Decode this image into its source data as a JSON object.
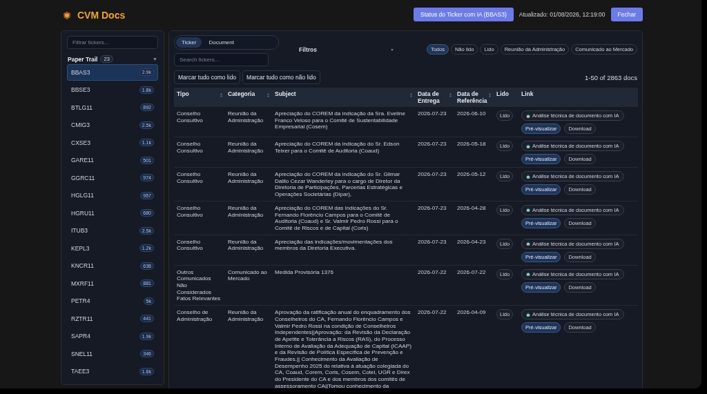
{
  "header": {
    "title": "CVM Docs",
    "status_button": "Status do Ticker com IA (BBAS3)",
    "updated": "Atualizado: 01/08/2026, 12:19:00",
    "close_button": "Fechar"
  },
  "sidebar": {
    "filter_placeholder": "Filtrar tickers...",
    "section": {
      "title": "Paper Trail",
      "count": "23",
      "expanded": true
    },
    "items": [
      {
        "label": "BBAS3",
        "count": "2.9k",
        "selected": true
      },
      {
        "label": "BBSE3",
        "count": "1.8k",
        "selected": false
      },
      {
        "label": "BTLG11",
        "count": "892",
        "selected": false
      },
      {
        "label": "CMIG3",
        "count": "2.5k",
        "selected": false
      },
      {
        "label": "CXSE3",
        "count": "1.1k",
        "selected": false
      },
      {
        "label": "GARE11",
        "count": "501",
        "selected": false
      },
      {
        "label": "GGRC11",
        "count": "974",
        "selected": false
      },
      {
        "label": "HGLG11",
        "count": "957",
        "selected": false
      },
      {
        "label": "HGRU11",
        "count": "680",
        "selected": false
      },
      {
        "label": "ITUB3",
        "count": "2.5k",
        "selected": false
      },
      {
        "label": "KEPL3",
        "count": "1.2k",
        "selected": false
      },
      {
        "label": "KNCR11",
        "count": "638",
        "selected": false
      },
      {
        "label": "MXRF11",
        "count": "881",
        "selected": false
      },
      {
        "label": "PETR4",
        "count": "5k",
        "selected": false
      },
      {
        "label": "RZTR11",
        "count": "441",
        "selected": false
      },
      {
        "label": "SAPR4",
        "count": "1.9k",
        "selected": false
      },
      {
        "label": "SNEL11",
        "count": "346",
        "selected": false
      },
      {
        "label": "TAEE3",
        "count": "1.6k",
        "selected": false
      }
    ]
  },
  "tabs": [
    {
      "label": "Ticker",
      "selected": true
    },
    {
      "label": "Document",
      "selected": false
    }
  ],
  "search": {
    "placeholder": "Search tickers..."
  },
  "filters": {
    "title": "Filtros",
    "expanded": false,
    "chips": [
      {
        "label": "Todos",
        "selected": true
      },
      {
        "label": "Não lido",
        "selected": false
      },
      {
        "label": "Lido",
        "selected": false
      },
      {
        "label": "Reunião da Administração",
        "selected": false
      },
      {
        "label": "Comunicado ao Mercado",
        "selected": false
      }
    ]
  },
  "actions": [
    "Marcar tudo como lido",
    "Marcar tudo como não lido"
  ],
  "pagination": "1-50 of 2863 docs",
  "table": {
    "columns": [
      {
        "label": "Tipo",
        "sortable": true
      },
      {
        "label": "Categoria",
        "sortable": true
      },
      {
        "label": "Subject",
        "sortable": true
      },
      {
        "label": "Data de Entrega",
        "sortable": true
      },
      {
        "label": "Data de Referência",
        "sortable": true
      },
      {
        "label": "Lido",
        "sortable": false
      },
      {
        "label": "Link",
        "sortable": false
      }
    ],
    "rows": [
      {
        "tipo": "Conselho Consultivo",
        "categoria": "Reunião da Administração",
        "subject": "Apreciação do COREM da indicação da Sra. Eveline Franco Veloso para o Comitê de Sustentabilidade Empresarial (Cosem)",
        "entrega": "2026-07-23",
        "referencia": "2026-06-10",
        "lido": "Lido",
        "analysis": "Análise técnica de documento com IA",
        "preview": "Pré-visualizar",
        "download": "Download"
      },
      {
        "tipo": "Conselho Consultivo",
        "categoria": "Reunião da Administração",
        "subject": "Apreciação do COREM da indicação do Sr. Edson Teixer para o Comitê de Auditoria (Coaud)",
        "entrega": "2026-07-23",
        "referencia": "2026-05-18",
        "lido": "Lido",
        "analysis": "Análise técnica de documento com IA",
        "preview": "Pré-visualizar",
        "download": "Download"
      },
      {
        "tipo": "Conselho Consultivo",
        "categoria": "Reunião da Administração",
        "subject": "Apreciação do COREM da indicação do Sr. Gilmar Dalilo Cezar Wanderley para o cargo de Diretor da Diretoria de Participações, Parcerias Estratégicas e Operações Societárias (Dipar),",
        "entrega": "2026-07-23",
        "referencia": "2026-05-12",
        "lido": "Lido",
        "analysis": "Análise técnica de documento com IA",
        "preview": "Pré-visualizar",
        "download": "Download"
      },
      {
        "tipo": "Conselho Consultivo",
        "categoria": "Reunião da Administração",
        "subject": "Apreciação do COREM das indicações do Sr. Fernando Florêncio Campos para o Comitê de Auditoria (Coaud) e Sr. Valmir Pedro Rossi para o Comitê de Riscos e de Capital (Coris)",
        "entrega": "2026-07-23",
        "referencia": "2026-04-28",
        "lido": "Lido",
        "analysis": "Análise técnica de documento com IA",
        "preview": "Pré-visualizar",
        "download": "Download"
      },
      {
        "tipo": "Conselho Consultivo",
        "categoria": "Reunião da Administração",
        "subject": "Apreciação das indicações/movimentações dos membros da Diretoria Executiva.",
        "entrega": "2026-07-23",
        "referencia": "2026-04-23",
        "lido": "Lido",
        "analysis": "Análise técnica de documento com IA",
        "preview": "Pré-visualizar",
        "download": "Download"
      },
      {
        "tipo": "Outros Comunicados Não Considerados Fatos Relevantes",
        "categoria": "Comunicado ao Mercado",
        "subject": "Medida Provisória 1376",
        "entrega": "2026-07-22",
        "referencia": "2026-07-22",
        "lido": "Lido",
        "analysis": "Análise técnica de documento com IA",
        "preview": "Pré-visualizar",
        "download": "Download"
      },
      {
        "tipo": "Conselho de Administração",
        "categoria": "Reunião da Administração",
        "subject": "Aprovação da ratificação anual do enquadramento dos Conselheiros do CA, Fernando Florêncio Campos e Valmir Pedro Rossi na condição de Conselheiros Independentes||Aprovação: da Revisão da Declaração de Apetite e Tolerância a Riscos (RAS), do Processo Interno de Avaliação da Adequação de Capital (ICAAP) e da Revisão de Política Específica de Prevenção e Fraudes.|| Conhecimento da Avaliação de Desempenho 2025 do relativa à atuação colegiada do CA, Coaud, Corem, Coris, Cosem, Cotei, UGR e Direx do Presidente do CA e dos membros dos comitês de assessoramento CA||Tomou conhecimento da",
        "entrega": "2026-07-22",
        "referencia": "2026-04-09",
        "lido": "Lido",
        "analysis": "Análise técnica de documento com IA",
        "preview": "Pré-visualizar",
        "download": "Download"
      }
    ]
  }
}
